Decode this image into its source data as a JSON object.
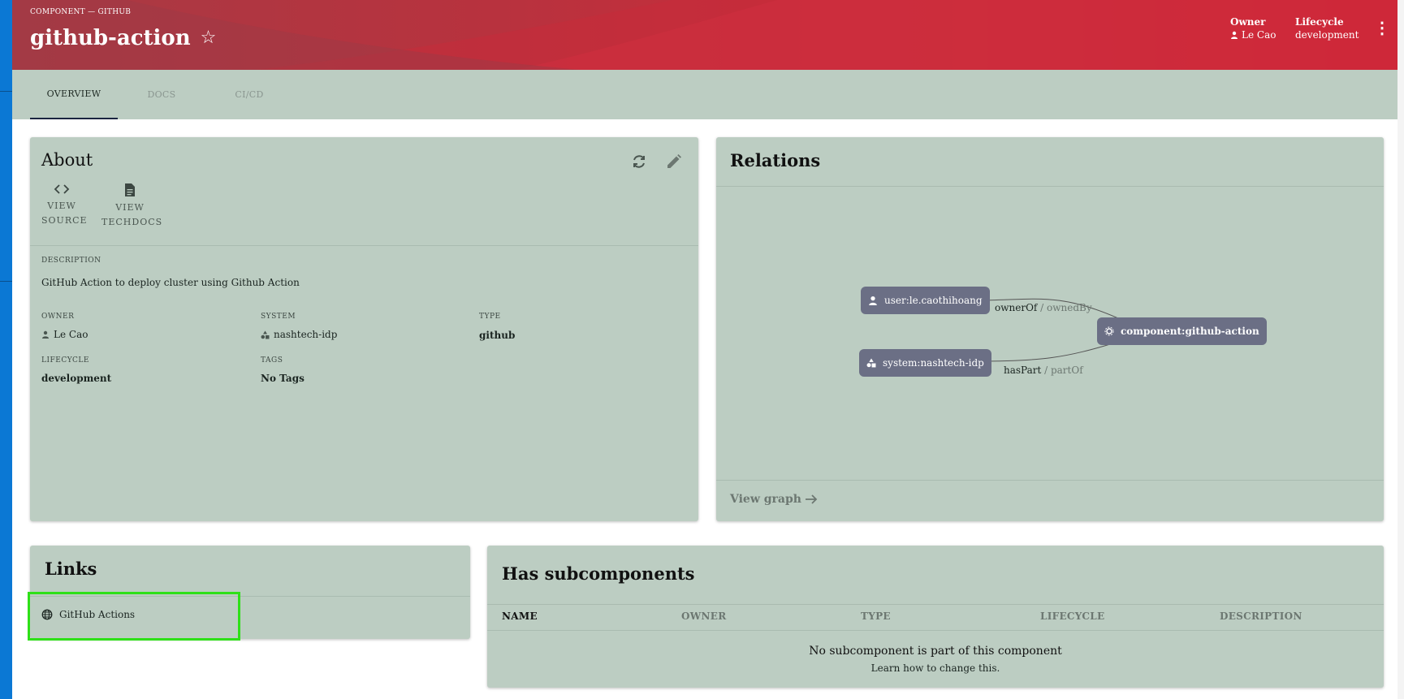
{
  "header": {
    "breadcrumb": "COMPONENT — GITHUB",
    "title": "github-action",
    "owner_label": "Owner",
    "owner_value": "Le Cao",
    "lifecycle_label": "Lifecycle",
    "lifecycle_value": "development"
  },
  "tabs": [
    {
      "label": "OVERVIEW",
      "active": true
    },
    {
      "label": "DOCS",
      "active": false
    },
    {
      "label": "CI/CD",
      "active": false
    }
  ],
  "about": {
    "title": "About",
    "links": [
      {
        "line1": "VIEW",
        "line2": "SOURCE",
        "icon": "code-icon"
      },
      {
        "line1": "VIEW",
        "line2": "TECHDOCS",
        "icon": "document-icon"
      }
    ],
    "description_label": "DESCRIPTION",
    "description": "GitHub Action to deploy cluster using Github Action",
    "owner_label": "OWNER",
    "owner": "Le Cao",
    "system_label": "SYSTEM",
    "system": "nashtech-idp",
    "type_label": "TYPE",
    "type": "github",
    "lifecycle_label": "LIFECYCLE",
    "lifecycle": "development",
    "tags_label": "TAGS",
    "tags": "No Tags"
  },
  "relations": {
    "title": "Relations",
    "nodes": {
      "user": "user:le.caothihoang",
      "system": "system:nashtech-idp",
      "component": "component:github-action"
    },
    "edges": {
      "owner_forward": "ownerOf",
      "owner_reverse": " / ownedBy",
      "part_forward": "hasPart",
      "part_reverse": " / partOf"
    },
    "view_graph": "View graph"
  },
  "links": {
    "title": "Links",
    "items": [
      {
        "label": "GitHub Actions",
        "icon": "globe-icon"
      }
    ]
  },
  "subcomponents": {
    "title": "Has subcomponents",
    "columns": [
      "NAME",
      "OWNER",
      "TYPE",
      "LIFECYCLE",
      "DESCRIPTION"
    ],
    "empty_message": "No subcomponent is part of this component",
    "learn_link": "Learn how to change this."
  },
  "colors": {
    "header_start": "#a83a44",
    "header_end": "#d40f24",
    "card_bg": "#bccdc2",
    "node_bg": "#6b6f85",
    "highlight": "#2ee018",
    "left_rail": "#0b78d4"
  }
}
